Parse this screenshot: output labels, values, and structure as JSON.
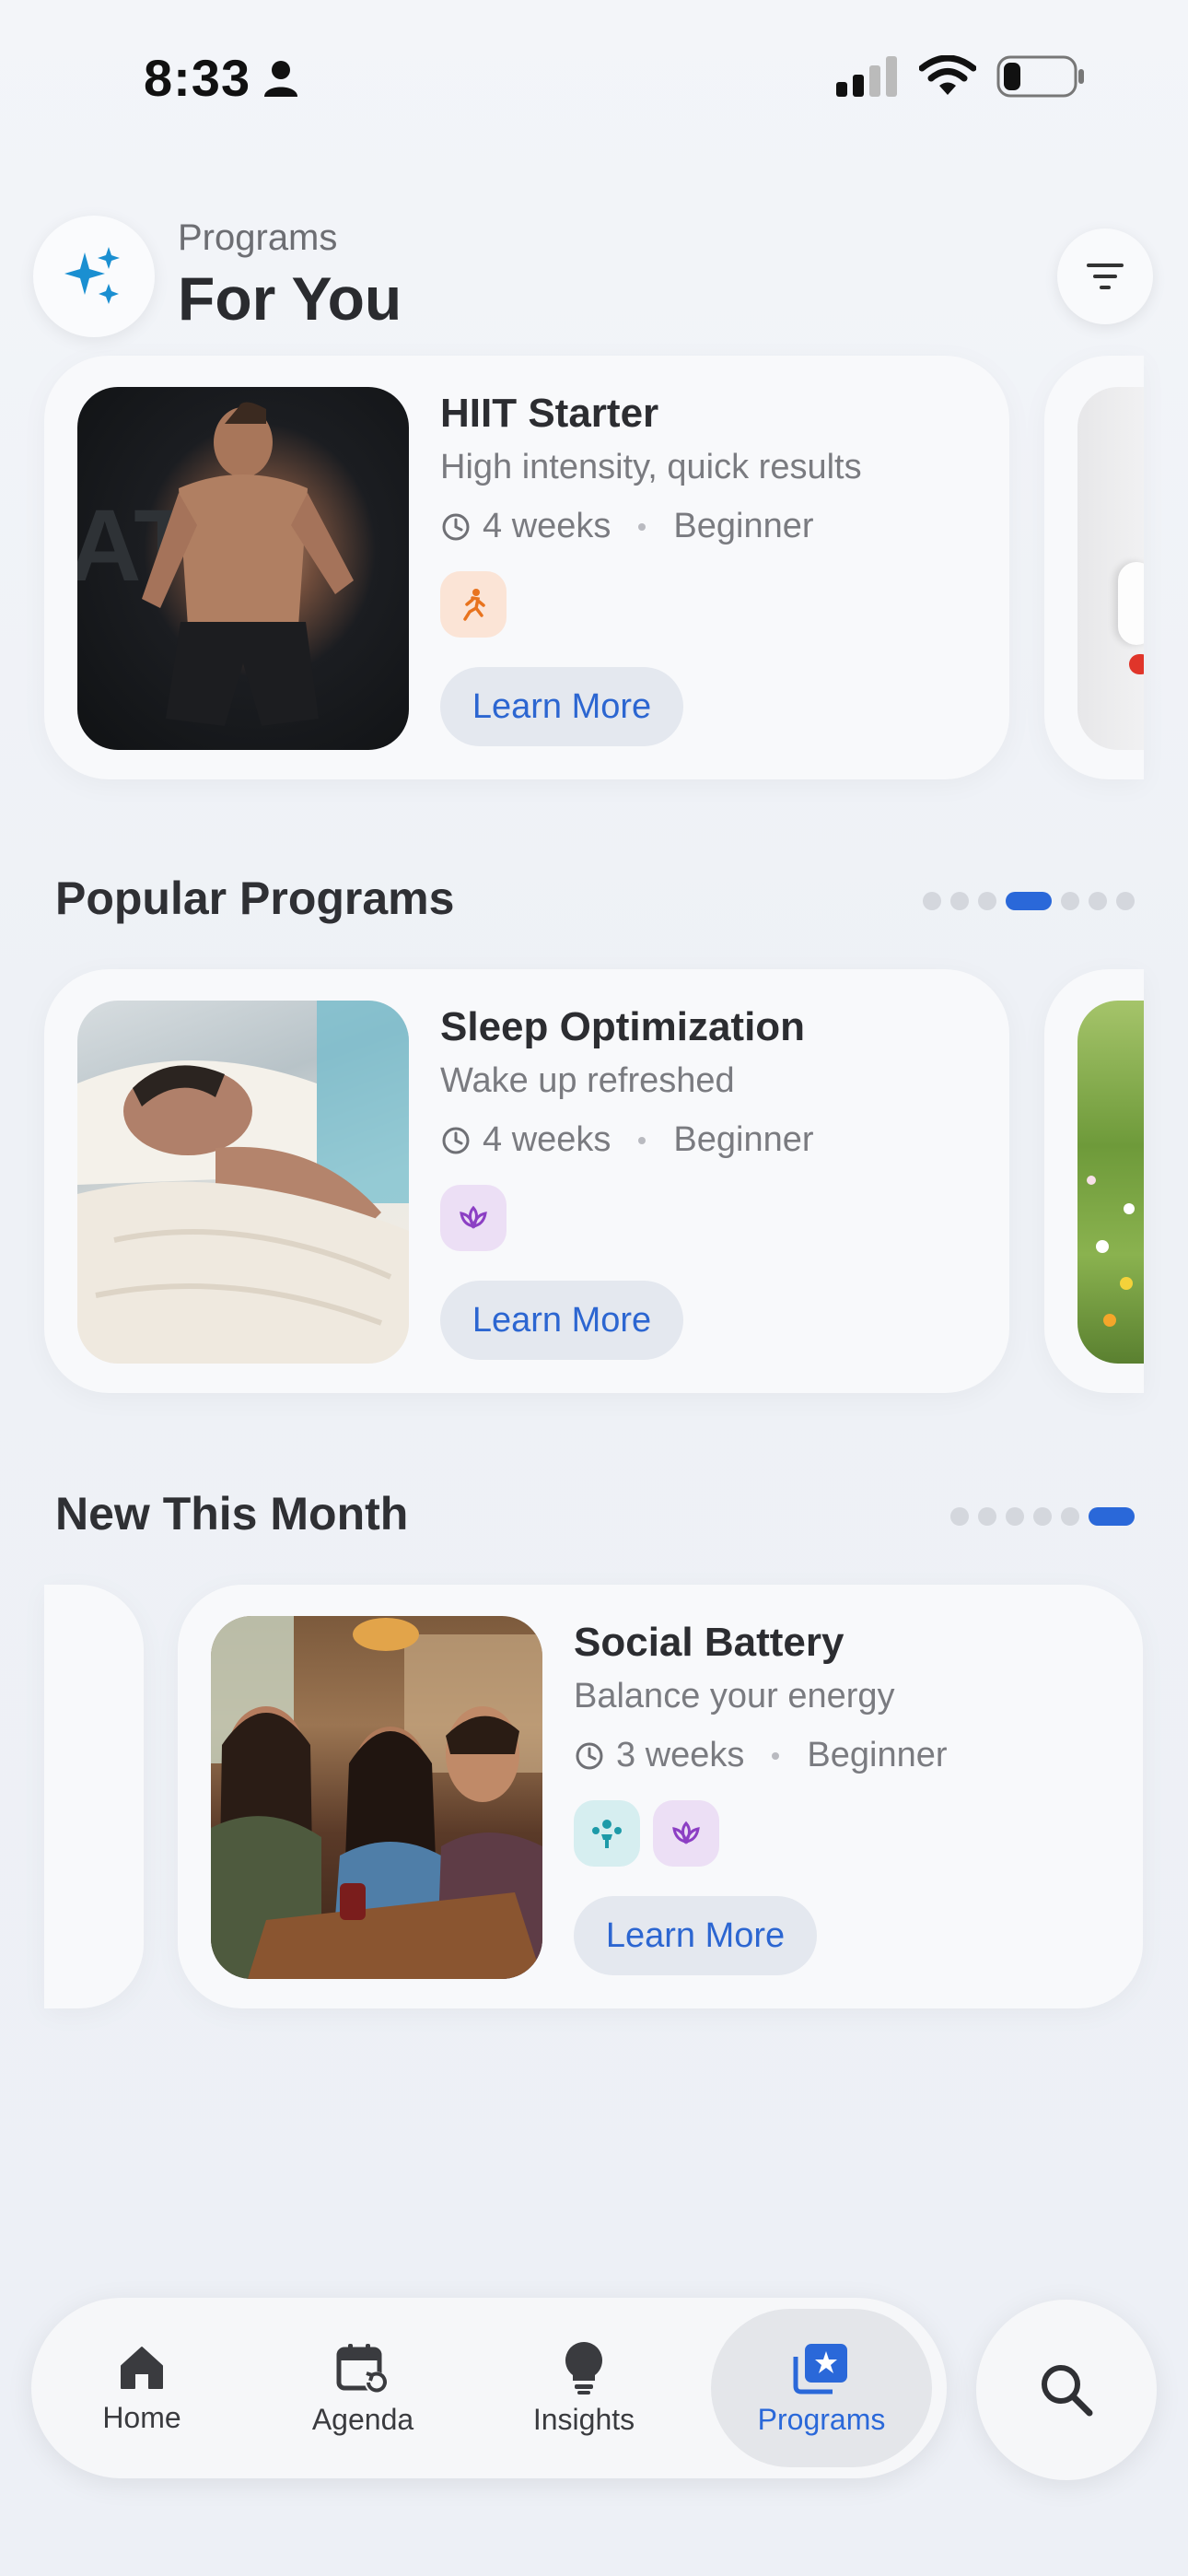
{
  "status_bar": {
    "time": "8:33"
  },
  "header": {
    "subtitle": "Programs",
    "title": "For You"
  },
  "featured": {
    "title": "HIIT Starter",
    "subtitle": "High intensity, quick results",
    "duration": "4 weeks",
    "level": "Beginner",
    "button": "Learn More"
  },
  "popular": {
    "section_title": "Popular Programs",
    "card": {
      "title": "Sleep Optimization",
      "subtitle": "Wake up refreshed",
      "duration": "4 weeks",
      "level": "Beginner",
      "button": "Learn More"
    }
  },
  "new_month": {
    "section_title": "New This Month",
    "card": {
      "title": "Social Battery",
      "subtitle": "Balance your energy",
      "duration": "3 weeks",
      "level": "Beginner",
      "button": "Learn More"
    }
  },
  "nav": {
    "items": [
      {
        "label": "Home",
        "icon": "home-icon"
      },
      {
        "label": "Agenda",
        "icon": "calendar-icon"
      },
      {
        "label": "Insights",
        "icon": "lightbulb-icon"
      },
      {
        "label": "Programs",
        "icon": "programs-icon"
      }
    ]
  },
  "colors": {
    "accent": "#2a68d9",
    "background": "#eef1f6"
  }
}
